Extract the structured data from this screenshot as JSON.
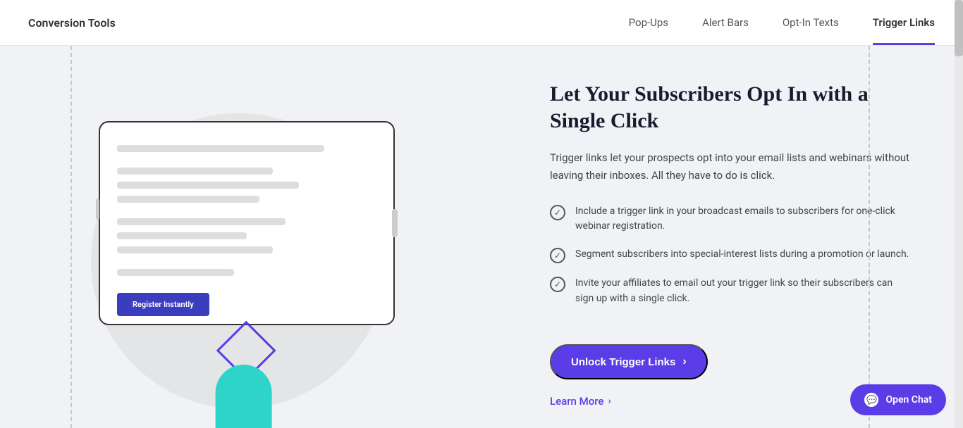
{
  "nav": {
    "logo": "Conversion Tools",
    "tabs": [
      {
        "label": "Pop-Ups",
        "active": false
      },
      {
        "label": "Alert Bars",
        "active": false
      },
      {
        "label": "Opt-In Texts",
        "active": false
      },
      {
        "label": "Trigger Links",
        "active": true
      }
    ]
  },
  "illustration": {
    "register_btn_label": "Register Instantly"
  },
  "content": {
    "heading": "Let Your Subscribers Opt In with a Single Click",
    "description": "Trigger links let your prospects opt into your email lists and webinars without leaving their inboxes. All they have to do is click.",
    "features": [
      "Include a trigger link in your broadcast emails to subscribers for one-click webinar registration.",
      "Segment subscribers into special-interest lists during a promotion or launch.",
      "Invite your affiliates to email out your trigger link so their subscribers can sign up with a single click."
    ],
    "unlock_btn_label": "Unlock Trigger Links",
    "learn_more_label": "Learn More"
  },
  "chat": {
    "label": "Open Chat"
  }
}
